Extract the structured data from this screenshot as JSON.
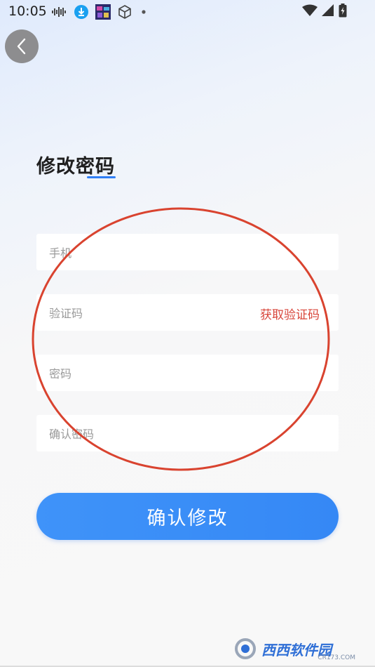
{
  "status_bar": {
    "time": "10:05",
    "left_icons": [
      "audio-wave-icon",
      "download-badge-icon",
      "app-thumbnail-icon",
      "cube-icon",
      "dot-icon"
    ],
    "right_icons": [
      "wifi-icon",
      "signal-icon",
      "battery-charging-icon"
    ]
  },
  "header": {
    "back_icon": "chevron-left-icon",
    "title": "修改密码"
  },
  "form": {
    "phone": {
      "placeholder": "手机",
      "value": ""
    },
    "code": {
      "placeholder": "验证码",
      "value": "",
      "get_code_label": "获取验证码"
    },
    "password": {
      "placeholder": "密码",
      "value": ""
    },
    "confirm_password": {
      "placeholder": "确认密码",
      "value": ""
    }
  },
  "actions": {
    "confirm_label": "确认修改"
  },
  "watermark": {
    "brand": "西西软件园",
    "sub": "CR173.COM"
  },
  "colors": {
    "accent": "#3588f5",
    "link_red": "#d8453a",
    "annotation_red": "#d9432f"
  }
}
